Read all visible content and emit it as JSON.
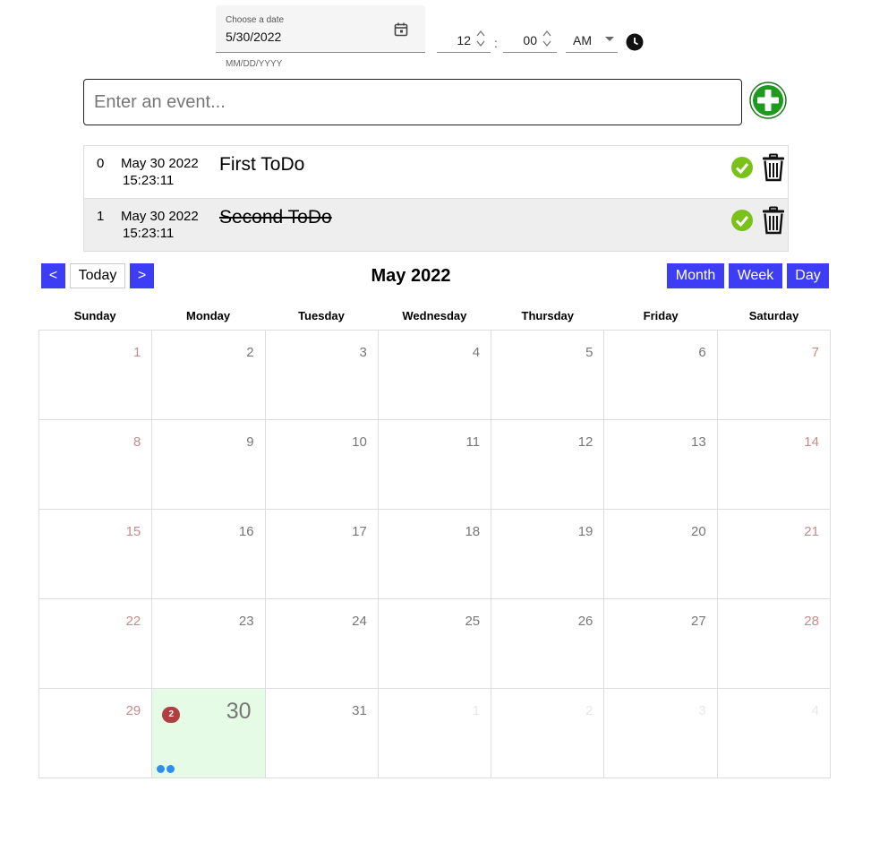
{
  "date_picker": {
    "label": "Choose a date",
    "value": "5/30/2022",
    "helper": "MM/DD/YYYY"
  },
  "time_picker": {
    "hour": "12",
    "separator": ":",
    "minute": "00",
    "ampm": "AM"
  },
  "event_input": {
    "placeholder": "Enter an event..."
  },
  "todos": [
    {
      "index": "0",
      "date": "May 30 2022",
      "time": "15:23:11",
      "text": "First ToDo",
      "completed": false
    },
    {
      "index": "1",
      "date": "May 30 2022",
      "time": "15:23:11",
      "text": "Second ToDo",
      "completed": true
    }
  ],
  "calendar": {
    "prev_label": "<",
    "today_label": "Today",
    "next_label": ">",
    "title": "May 2022",
    "views": [
      "Month",
      "Week",
      "Day"
    ],
    "weekdays": [
      "Sunday",
      "Monday",
      "Tuesday",
      "Wednesday",
      "Thursday",
      "Friday",
      "Saturday"
    ],
    "weeks": [
      [
        "1",
        "2",
        "3",
        "4",
        "5",
        "6",
        "7"
      ],
      [
        "8",
        "9",
        "10",
        "11",
        "12",
        "13",
        "14"
      ],
      [
        "15",
        "16",
        "17",
        "18",
        "19",
        "20",
        "21"
      ],
      [
        "22",
        "23",
        "24",
        "25",
        "26",
        "27",
        "28"
      ],
      [
        "29",
        "30",
        "31",
        "1",
        "2",
        "3",
        "4"
      ]
    ],
    "today_date": "30",
    "today_event_count": "2",
    "today_event_dots": 2,
    "accent_color": "#3d3df5",
    "today_bg": "#e6fbe6"
  }
}
